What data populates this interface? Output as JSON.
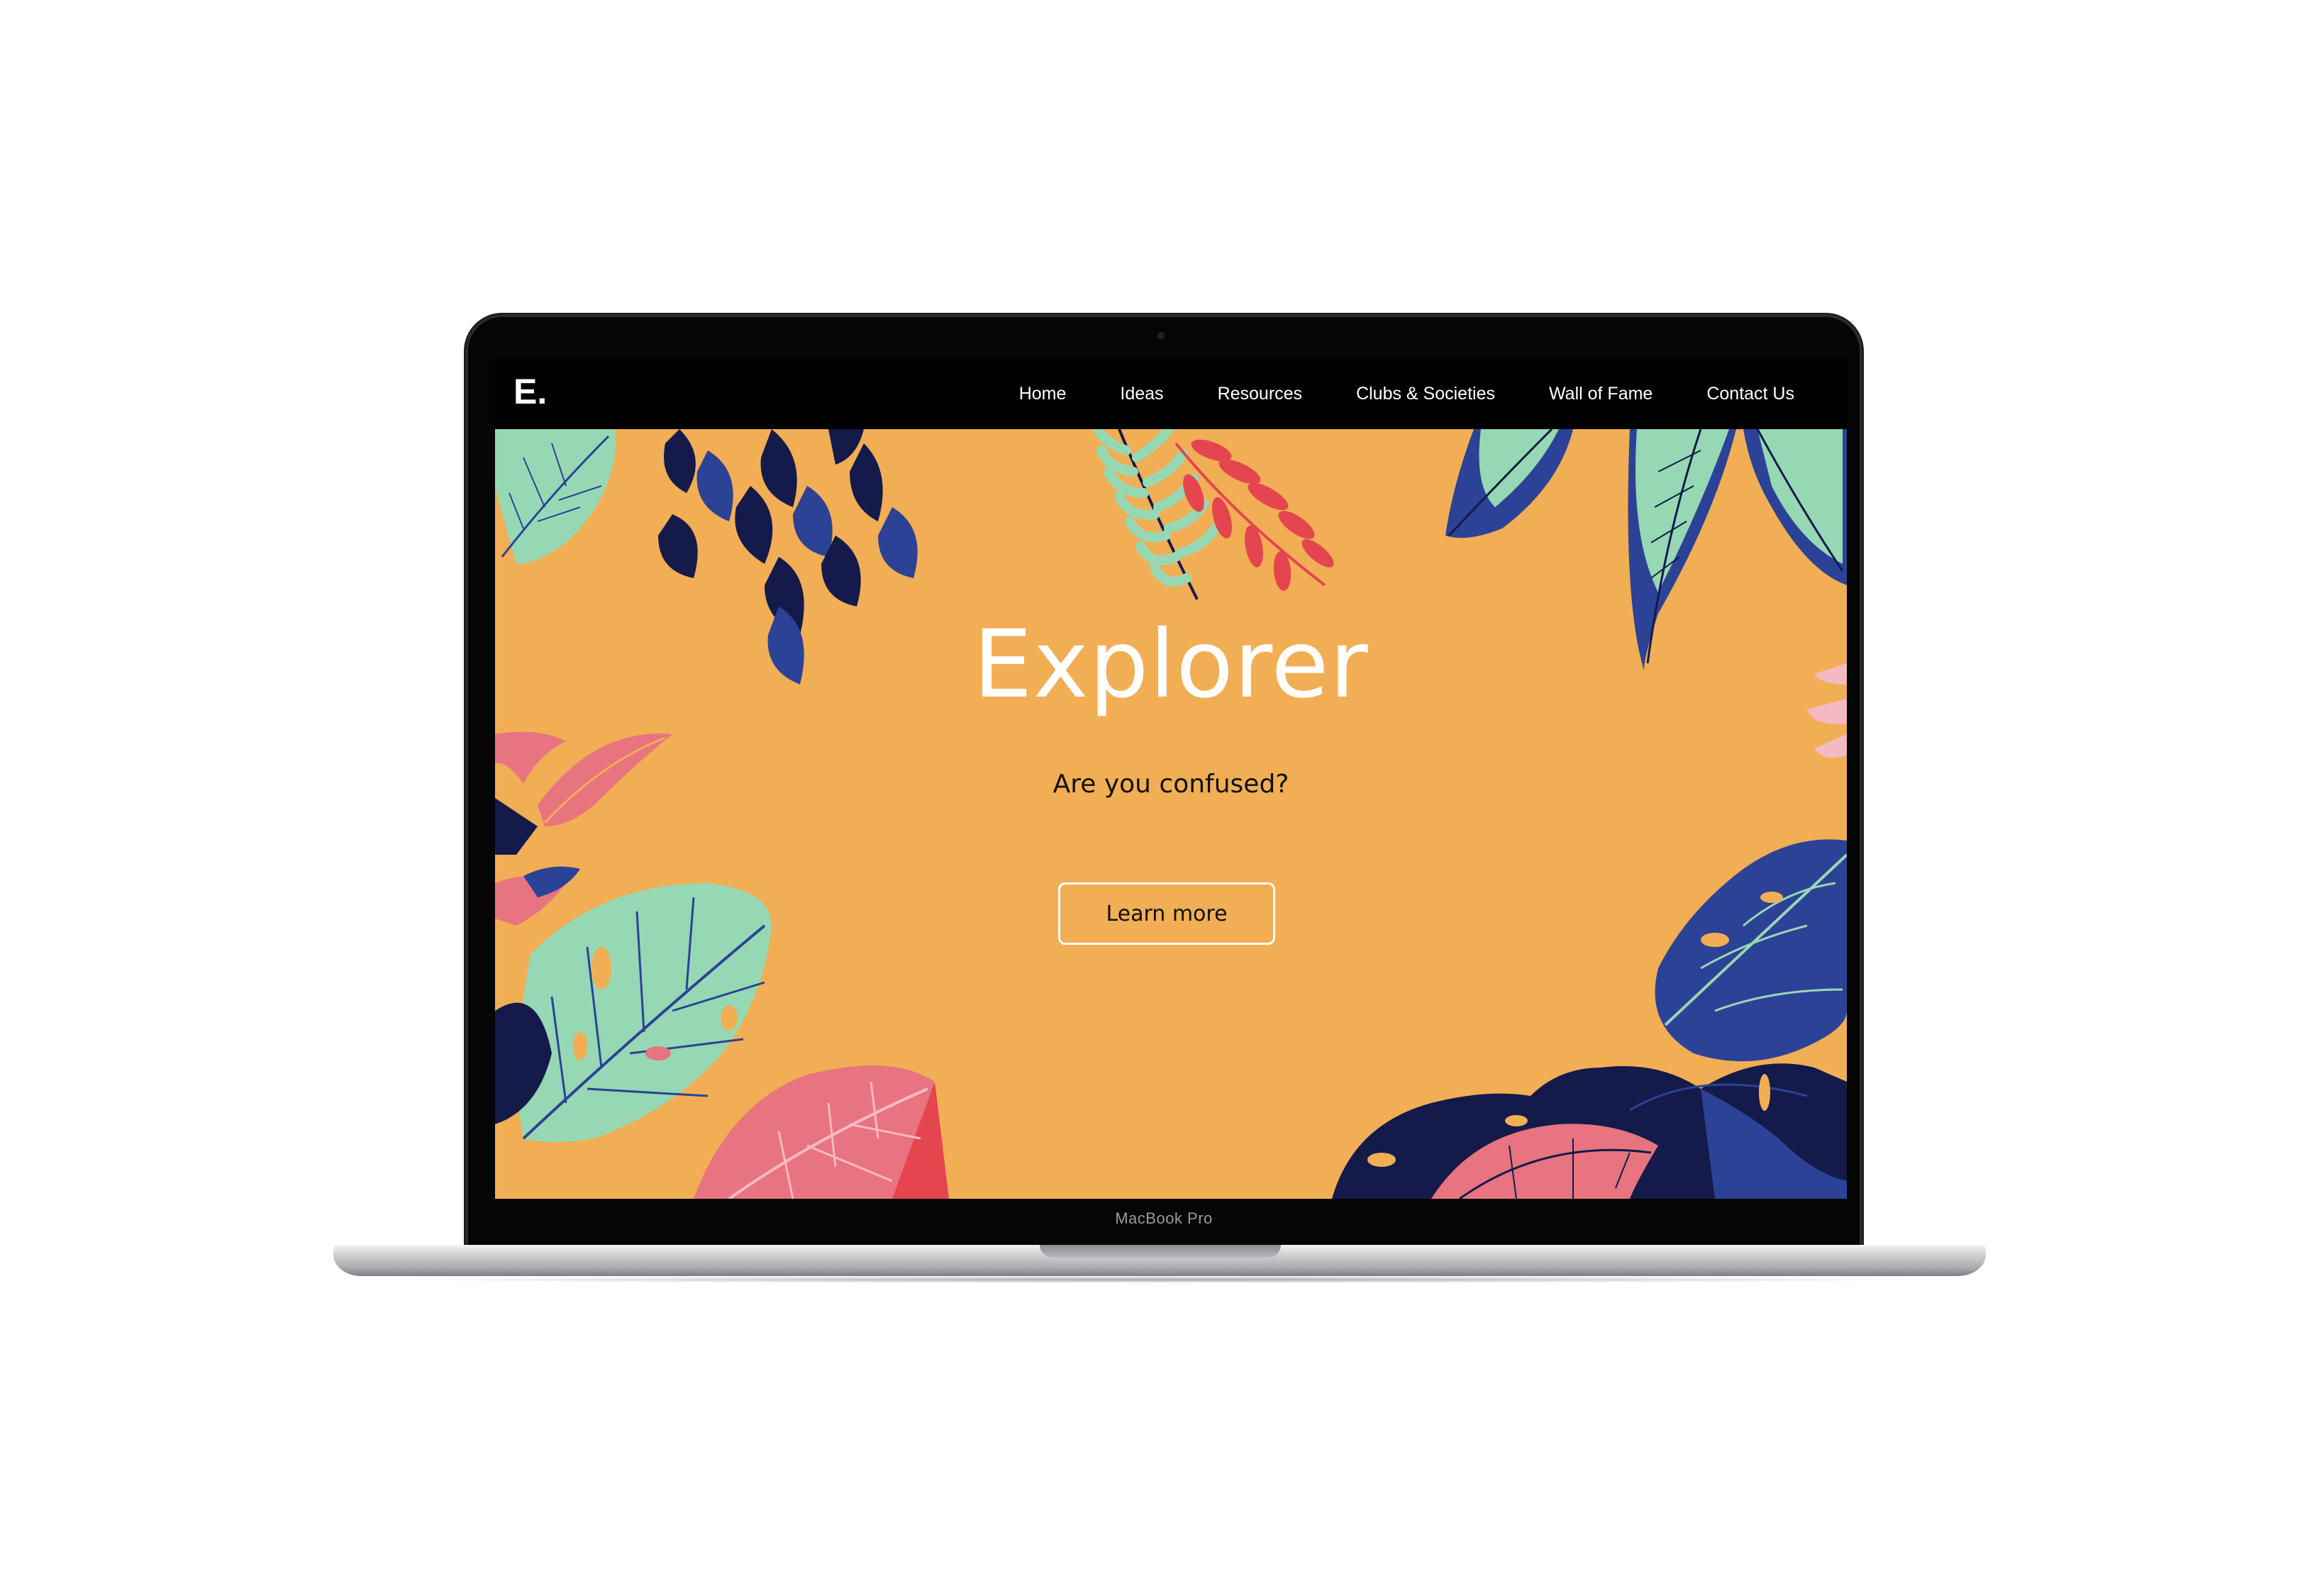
{
  "device": {
    "label": "MacBook Pro"
  },
  "site": {
    "logo": "E.",
    "nav": {
      "items": [
        {
          "label": "Home"
        },
        {
          "label": "Ideas"
        },
        {
          "label": "Resources"
        },
        {
          "label": "Clubs & Societies"
        },
        {
          "label": "Wall of Fame"
        },
        {
          "label": "Contact Us"
        }
      ]
    },
    "hero": {
      "title": "Explorer",
      "subtitle": "Are you confused?",
      "cta_label": "Learn more"
    }
  },
  "colors": {
    "hero_background": "#f1ae55",
    "nav_background": "#000000",
    "leaf_navy": "#141a4a",
    "leaf_blue": "#2c4296",
    "leaf_mint": "#97d8b4",
    "leaf_pink": "#e7747f",
    "leaf_red": "#e5454f",
    "leaf_light_pink": "#f5b9c4"
  }
}
